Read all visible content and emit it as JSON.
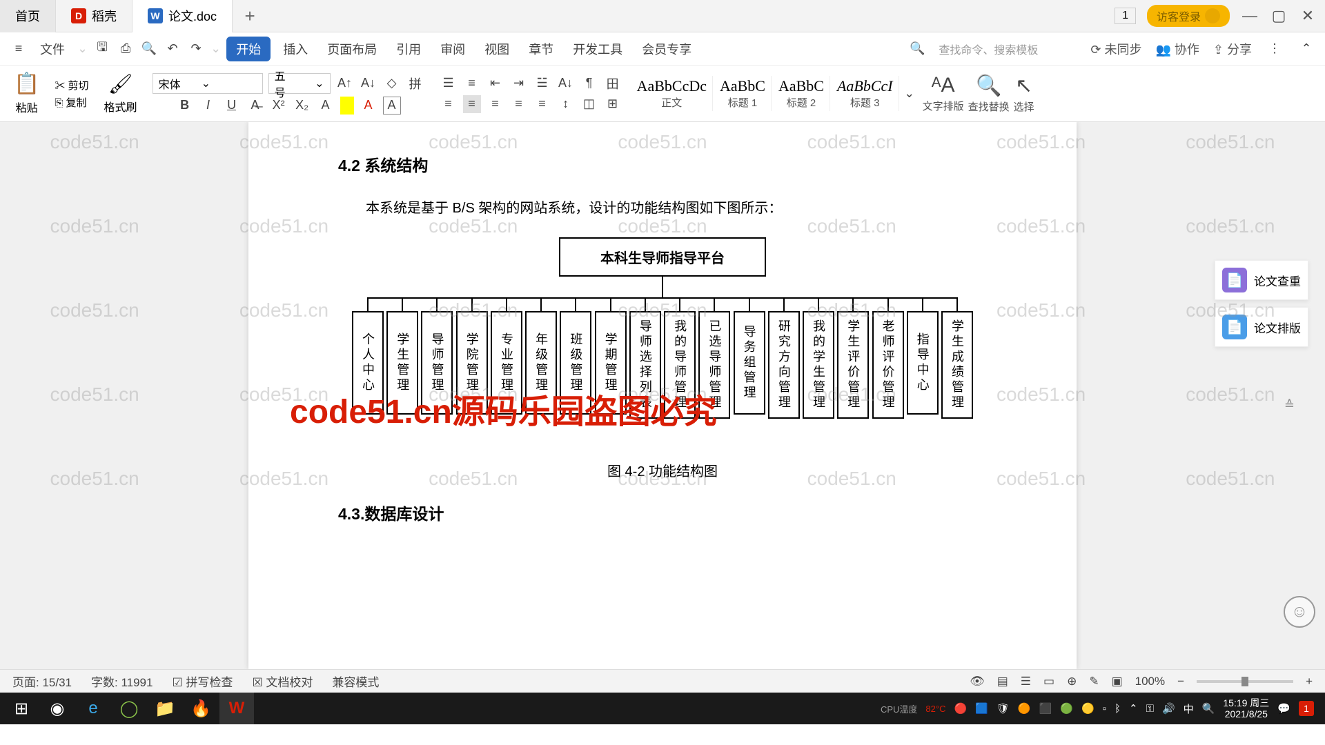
{
  "tabs": {
    "home": "首页",
    "docell": "稻壳",
    "doc": "论文.doc",
    "add": "+"
  },
  "titleright": {
    "page": "1",
    "login": "访客登录"
  },
  "menubar": {
    "file": "文件",
    "items": [
      "开始",
      "插入",
      "页面布局",
      "引用",
      "审阅",
      "视图",
      "章节",
      "开发工具",
      "会员专享"
    ],
    "search": "查找命令、搜索模板",
    "sync": "未同步",
    "collab": "协作",
    "share": "分享"
  },
  "ribbon": {
    "paste": "粘贴",
    "cut": "剪切",
    "copy": "复制",
    "brush": "格式刷",
    "font": "宋体",
    "size": "五号",
    "styles": [
      {
        "p": "AaBbCcDc",
        "l": "正文"
      },
      {
        "p": "AaBbC",
        "l": "标题 1"
      },
      {
        "p": "AaBbC",
        "l": "标题 2"
      },
      {
        "p": "AaBbCcI",
        "l": "标题 3"
      }
    ],
    "layout": "文字排版",
    "find": "查找替换",
    "select": "选择"
  },
  "doc": {
    "h_42": "4.2 系统结构",
    "para": "本系统是基于 B/S 架构的网站系统，设计的功能结构图如下图所示：",
    "title_box": "本科生导师指导平台",
    "cols": [
      "个人中心",
      "学生管理",
      "导师管理",
      "学院管理",
      "专业管理",
      "年级管理",
      "班级管理",
      "学期管理",
      "导师选择列表",
      "我的导师管理",
      "已选导师管理",
      "导务组管理",
      "研究方向管理",
      "我的学生管理",
      "学生评价管理",
      "老师评价管理",
      "指导中心",
      "学生成绩管理"
    ],
    "caption": "图 4-2 功能结构图",
    "h_43": "4.3.数据库设计"
  },
  "side": {
    "a": "论文查重",
    "b": "论文排版"
  },
  "wm_main": "code51.cn源码乐园盗图必究",
  "wm": "code51.cn",
  "status": {
    "page": "页面: 15/31",
    "words": "字数: 11991",
    "spell": "拼写检查",
    "proof": "文档校对",
    "compat": "兼容模式",
    "zoom": "100%"
  },
  "tray": {
    "cpu": "CPU温度",
    "temp": "82°C",
    "ime": "中",
    "time": "15:19 周三",
    "date": "2021/8/25",
    "notif": "1"
  }
}
